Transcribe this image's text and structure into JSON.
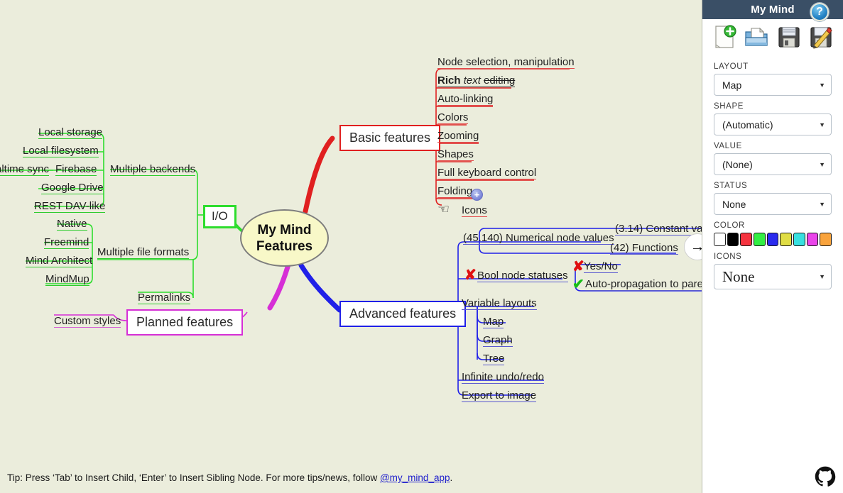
{
  "app": {
    "background_color": "#ebeddc",
    "header_color": "#3a4f66"
  },
  "canvas": {
    "central_node": {
      "line1": "My Mind",
      "line2": "Features"
    },
    "help_icon_label": "?",
    "pan_arrow_label": "→",
    "branches": [
      {
        "name": "io",
        "label": "I/O",
        "color": "#2ddd2d",
        "children": [
          {
            "label": "Multiple backends",
            "children": [
              "Local storage",
              "Local filesystem",
              "Firebase",
              "Google Drive",
              "REST DAV-like"
            ]
          },
          {
            "label": "Multiple file formats",
            "children": [
              "Native",
              "Freemind",
              "Mind Architect",
              "MindMup"
            ]
          }
        ],
        "extra": [
          {
            "label": "altime sync",
            "note": "clipped-left"
          }
        ]
      },
      {
        "name": "basic-features",
        "label": "Basic features",
        "color": "#e02020",
        "children": [
          "Node selection, manipulation",
          "Rich text editing",
          "Auto-linking",
          "Colors",
          "Zooming",
          "Shapes",
          "Full keyboard control",
          "Folding",
          "Icons"
        ],
        "rich_text": {
          "bold": "Rich",
          "italic": "text",
          "strike": "editing"
        }
      },
      {
        "name": "advanced-features",
        "label": "Advanced features",
        "color": "#2020e8",
        "children": [
          {
            "label": "Numerical node values",
            "value": "(45.140)",
            "children": [
              {
                "label": "Constant value",
                "value": "(3.14)"
              },
              {
                "label": "Functions",
                "value": "(42)"
              }
            ]
          },
          {
            "label": "Bool node statuses",
            "status": "no",
            "children": [
              {
                "label": "Yes/No",
                "status": "no"
              },
              {
                "label": "Auto-propagation to parent",
                "status": "yes"
              }
            ]
          },
          {
            "label": "Variable layouts",
            "children": [
              "Map",
              "Graph",
              "Tree"
            ]
          },
          {
            "label": "Infinite undo/redo"
          },
          {
            "label": "Export to image"
          }
        ]
      },
      {
        "name": "planned-features",
        "label": "Planned features",
        "color": "#d62fd6",
        "children": [
          "Permalinks",
          "Custom styles"
        ]
      }
    ]
  },
  "tip": {
    "before": "Tip: Press ‘Tab’ to Insert Child, ‘Enter’ to Insert Sibling Node. For more tips/news, follow ",
    "link": "@my_mind_app",
    "after": "."
  },
  "sidebar": {
    "title": "My Mind",
    "toolbar": [
      {
        "name": "new-file-icon",
        "label": "New"
      },
      {
        "name": "open-file-icon",
        "label": "Open"
      },
      {
        "name": "save-icon",
        "label": "Save"
      },
      {
        "name": "save-as-icon",
        "label": "Save as"
      }
    ],
    "fields": [
      {
        "name": "layout",
        "label": "LAYOUT",
        "value": "Map"
      },
      {
        "name": "shape",
        "label": "SHAPE",
        "value": "(Automatic)"
      },
      {
        "name": "value",
        "label": "VALUE",
        "value": "(None)"
      },
      {
        "name": "status",
        "label": "STATUS",
        "value": "None"
      }
    ],
    "color_label": "COLOR",
    "colors": [
      "#ffffff",
      "#000000",
      "#f5333f",
      "#33ee44",
      "#2a2aee",
      "#e0dd44",
      "#38e0e0",
      "#ea44ea",
      "#f9a33c"
    ],
    "icons_label": "ICONS",
    "icons_value": "None",
    "github_icon": "github-icon"
  }
}
